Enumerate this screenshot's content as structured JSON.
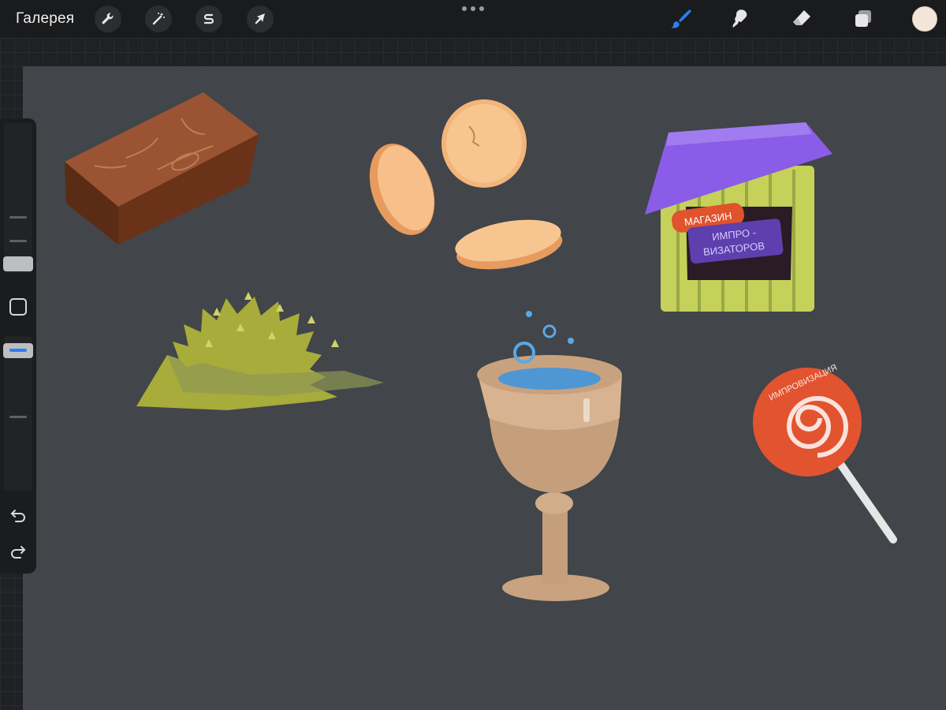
{
  "app": {
    "gallery_label": "Галерея"
  },
  "toolbar": {
    "left_tools": [
      "wrench-icon",
      "magic-wand-icon",
      "selection-icon",
      "transform-arrow-icon"
    ],
    "right_tools": [
      "brush-icon",
      "smudge-icon",
      "eraser-icon",
      "layers-icon"
    ],
    "active_tool": "brush-icon",
    "current_color": "#f3e6d8",
    "accent_color": "#2a7ef0"
  },
  "sidebar": {
    "brush_size_slider": "slider",
    "opacity_slider": "slider",
    "undo": "undo-icon",
    "redo": "redo-icon"
  },
  "canvas": {
    "background_color": "#424549",
    "shop_sign": {
      "label": "МАГАЗИН",
      "board_line1": "ИМПРО -",
      "board_line2": "ВИЗАТОРОВ"
    },
    "lollipop_text": "ИМПРОВИЗАЦИЯ"
  }
}
